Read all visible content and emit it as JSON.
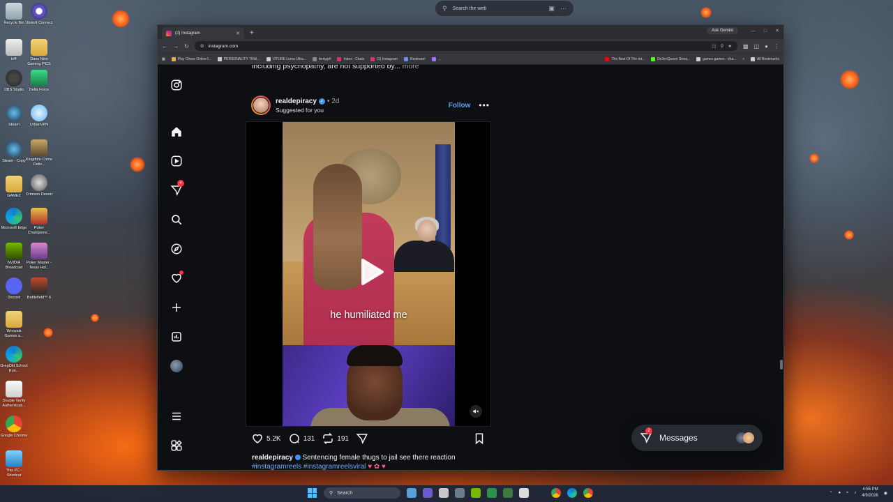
{
  "top_search": {
    "placeholder": "Search the web"
  },
  "desktop_icons": [
    {
      "label": "Recycle Bin"
    },
    {
      "label": "Ubisoft Connect"
    },
    {
      "label": "bf4"
    },
    {
      "label": "Dans New Gaming PICS"
    },
    {
      "label": "OBS Studio"
    },
    {
      "label": "Delta Force"
    },
    {
      "label": "Steam"
    },
    {
      "label": "UrbanVPN"
    },
    {
      "label": "Steam - Copy"
    },
    {
      "label": "Kingdom Come Deliv..."
    },
    {
      "label": "GAMEZ"
    },
    {
      "label": "Crimson Desert"
    },
    {
      "label": "Microsoft Edge"
    },
    {
      "label": "Poker Champions..."
    },
    {
      "label": "NVIDIA Broadcast"
    },
    {
      "label": "Poker Master - Texas Hol..."
    },
    {
      "label": "Discord"
    },
    {
      "label": "Battlefield™ 6"
    },
    {
      "label": "Wnoyals Games a..."
    },
    {
      "label": "GregOld School Run..."
    },
    {
      "label": "Double Verify Authenticati..."
    },
    {
      "label": "Google Chrome"
    },
    {
      "label": "This PC - Shortcut"
    }
  ],
  "browser": {
    "tab_title": "(2) Instagram",
    "new_tab": "+",
    "ask_gemini": "Ask Gemini",
    "url": "instagram.com",
    "bookmarks": [
      "Play Chess Online f...",
      "PERSONALITY TRAI...",
      "VITURE Luma Ultra...",
      "fentygirl",
      "Inbox - Chats",
      "(1) Instagram",
      "Restream",
      "...",
      "The Best Of The Int...",
      "DeJenQueen Strea...",
      "games games - sha..."
    ],
    "all_bookmarks": "All Bookmarks"
  },
  "instagram": {
    "nav": {
      "notification_badge": "4"
    },
    "previous_caption": {
      "text": "including psychopathy, are not supported by...",
      "more": "more"
    },
    "post": {
      "username": "realdepiracy",
      "time": "• 2d",
      "subtitle": "Suggested for you",
      "follow": "Follow",
      "video_subtitle": "he humiliated me",
      "likes": "5.2K",
      "comments": "131",
      "reposts": "191",
      "caption_user": "realdepiracy",
      "caption_text": "Sentencing female thugs to jail see there reaction",
      "hashtags": "#instagramreels #instagramreelsviral"
    },
    "messages": {
      "label": "Messages",
      "badge": "2"
    }
  },
  "taskbar": {
    "search": "Search",
    "time": "4:55 PM",
    "date": "4/9/2026"
  },
  "colors": {
    "instagram_bg": "#0d0f13",
    "follow_blue": "#5c9ff0",
    "badge_red": "#ff3040"
  }
}
